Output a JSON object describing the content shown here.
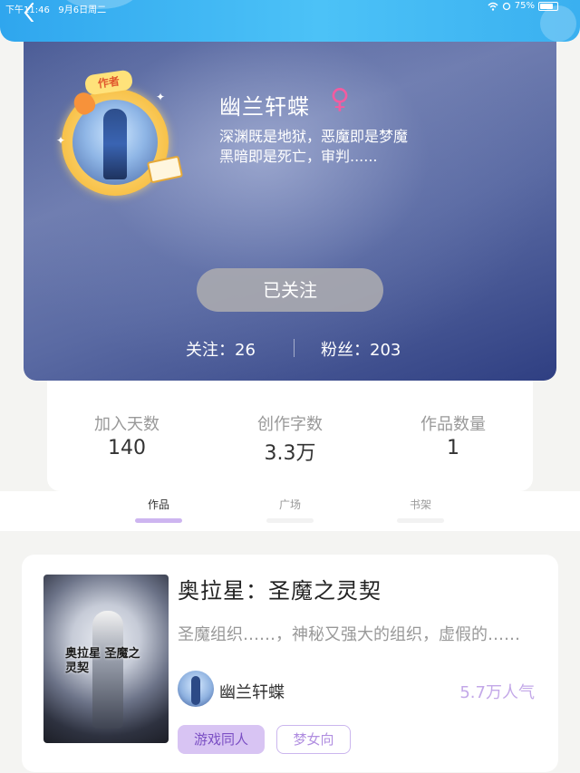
{
  "status_bar": {
    "time": "下午11:46",
    "date": "9月6日周二",
    "battery": "75%"
  },
  "author": {
    "badge": "作者",
    "name": "幽兰轩蝶",
    "gender_icon": "female-icon",
    "gender_color": "#f25ca0",
    "bio_line1": "深渊既是地狱，恶魔即是梦魔",
    "bio_line2": "黑暗即是死亡，审判......",
    "follow_button": "已关注",
    "follow_stat": "关注：26",
    "fans_stat": "粉丝：203"
  },
  "stats": [
    {
      "label": "加入天数",
      "value": "140"
    },
    {
      "label": "创作字数",
      "value": "3.3万"
    },
    {
      "label": "作品数量",
      "value": "1"
    }
  ],
  "tabs": [
    {
      "label": "作品",
      "active": true
    },
    {
      "label": "广场",
      "active": false
    },
    {
      "label": "书架",
      "active": false
    }
  ],
  "book": {
    "title": "奥拉星：圣魔之灵契",
    "cover_text": "奥拉星 圣魔之灵契",
    "description": "圣魔组织……，神秘又强大的组织，虚假的……",
    "author": "幽兰轩蝶",
    "popularity": "5.7万人气",
    "tags": [
      "游戏同人",
      "梦女向"
    ]
  },
  "colors": {
    "accent": "#c3a8e8",
    "top_bar": "#2fa6ee",
    "tab_active_underline": "#cdb5f0"
  }
}
